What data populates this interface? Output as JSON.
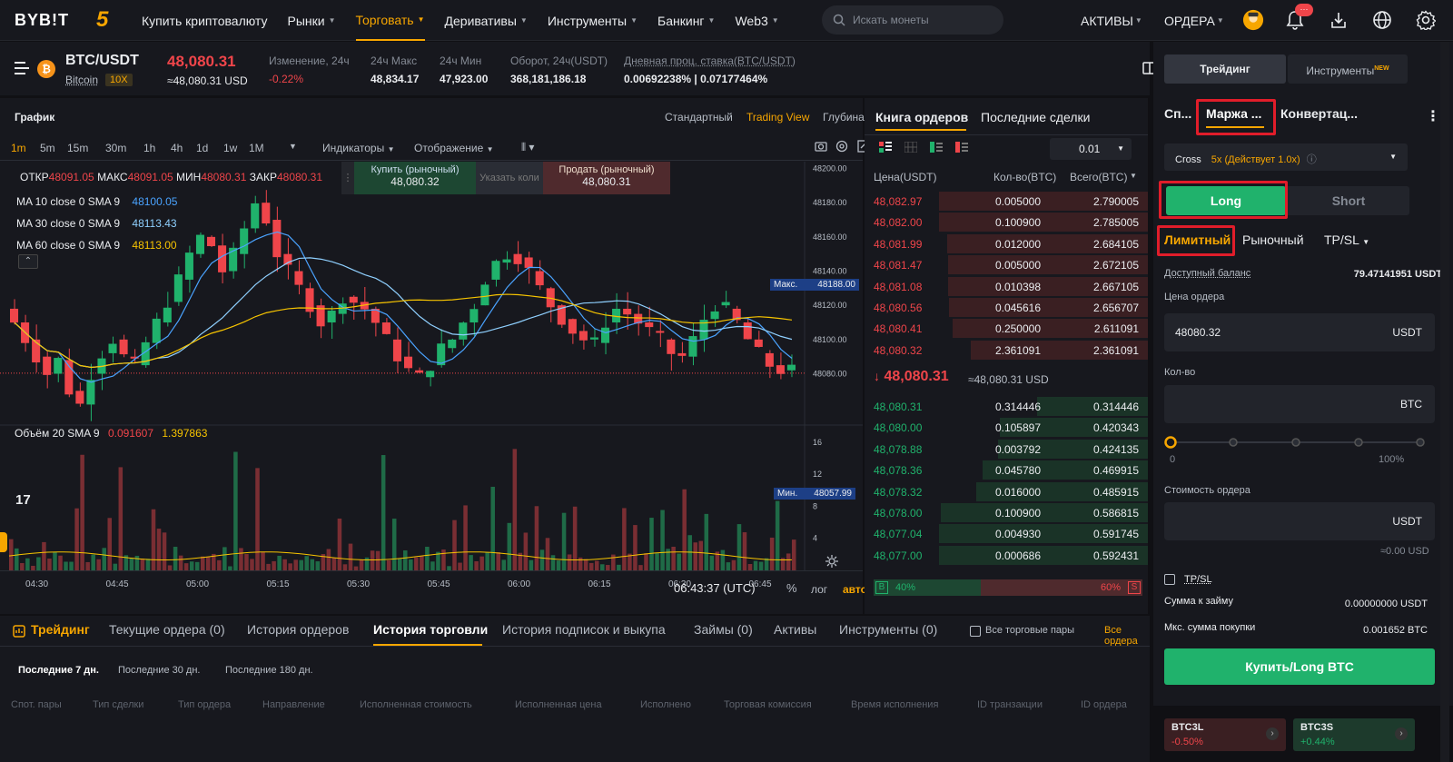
{
  "header": {
    "logo": "BYB!T",
    "five": "5",
    "nav": [
      "Купить криптовалюту",
      "Рынки",
      "Торговать",
      "Деривативы",
      "Инструменты",
      "Банкинг",
      "Web3"
    ],
    "search_placeholder": "Искать монеты",
    "assets": "АКТИВЫ",
    "orders": "ОРДЕРА",
    "notif_badge": "···"
  },
  "pair": {
    "symbol": "BTC/USDT",
    "name": "Bitcoin",
    "leverage": "10X",
    "price": "48,080.31",
    "price_usd": "≈48,080.31 USD",
    "change_label": "Изменение, 24ч",
    "change_value": "-0.22%",
    "high_label": "24ч Макс",
    "high_value": "48,834.17",
    "low_label": "24ч Мин",
    "low_value": "47,923.00",
    "turnover_label": "Оборот, 24ч(USDT)",
    "turnover_value": "368,181,186.18",
    "rate_label": "Дневная проц. ставка(BTC/USDT)",
    "rate_value": "0.00692238% | 0.07177464%"
  },
  "chart": {
    "title": "График",
    "views": [
      "Стандартный",
      "Trading View",
      "Глубина"
    ],
    "intervals": [
      "1m",
      "5m",
      "15m",
      "30m",
      "1h",
      "4h",
      "1d",
      "1w",
      "1M"
    ],
    "indicators_label": "Индикаторы",
    "display_label": "Отображение",
    "ohlc": {
      "o_label": "ОТКР",
      "o": "48091.05",
      "h_label": "МАКС",
      "h": "48091.05",
      "l_label": "МИН",
      "l": "48080.31",
      "c_label": "ЗАКР",
      "c": "48080.31"
    },
    "ma": [
      {
        "label": "MA 10 close 0 SMA 9",
        "value": "48100.05",
        "color": "#4aa3ff"
      },
      {
        "label": "MA 30 close 0 SMA 9",
        "value": "48113.43",
        "color": "#8fd0ff"
      },
      {
        "label": "MA 60 close 0 SMA 9",
        "value": "48113.00",
        "color": "#f7c400"
      }
    ],
    "quick": {
      "buy_label": "Купить (рыночный)",
      "buy_price": "48,080.32",
      "mid": "Указать коли",
      "sell_label": "Продать (рыночный)",
      "sell_price": "48,080.31"
    },
    "max_label": "Макс.",
    "max_value": "48188.00",
    "min_label": "Мин.",
    "min_value": "48057.99",
    "y_ticks": [
      "48200.00",
      "48180.00",
      "48160.00",
      "48140.00",
      "48120.00",
      "48100.00",
      "48080.00"
    ],
    "vol_label": "Объём 20 SMA 9",
    "vol_v1": "0.091607",
    "vol_v2": "1.397863",
    "vol_ticks": [
      "16",
      "12",
      "8",
      "4"
    ],
    "x_ticks": [
      "04:30",
      "04:45",
      "05:00",
      "05:15",
      "05:30",
      "05:45",
      "06:00",
      "06:15",
      "06:30",
      "06:45"
    ],
    "time": "06:43:37 (UTC)",
    "pct": "%",
    "log": "лог",
    "auto": "авто"
  },
  "chart_data": {
    "type": "candlestick",
    "price_range": [
      48057.99,
      48188.0
    ],
    "last_price": 48080.31
  },
  "orderbook": {
    "tabs": [
      "Книга ордеров",
      "Последние сделки"
    ],
    "step": "0.01",
    "headers": [
      "Цена(USDT)",
      "Кол-во(BTC)",
      "Всего(BTC)"
    ],
    "asks": [
      [
        "48,082.97",
        "0.005000",
        "2.790005"
      ],
      [
        "48,082.00",
        "0.100900",
        "2.785005"
      ],
      [
        "48,081.99",
        "0.012000",
        "2.684105"
      ],
      [
        "48,081.47",
        "0.005000",
        "2.672105"
      ],
      [
        "48,081.08",
        "0.010398",
        "2.667105"
      ],
      [
        "48,080.56",
        "0.045616",
        "2.656707"
      ],
      [
        "48,080.41",
        "0.250000",
        "2.611091"
      ],
      [
        "48,080.32",
        "2.361091",
        "2.361091"
      ]
    ],
    "mid_price": "48,080.31",
    "mid_usd": "≈48,080.31 USD",
    "bids": [
      [
        "48,080.31",
        "0.314446",
        "0.314446"
      ],
      [
        "48,080.00",
        "0.105897",
        "0.420343"
      ],
      [
        "48,078.88",
        "0.003792",
        "0.424135"
      ],
      [
        "48,078.36",
        "0.045780",
        "0.469915"
      ],
      [
        "48,078.32",
        "0.016000",
        "0.485915"
      ],
      [
        "48,078.00",
        "0.100900",
        "0.586815"
      ],
      [
        "48,077.04",
        "0.004930",
        "0.591745"
      ],
      [
        "48,077.00",
        "0.000686",
        "0.592431"
      ]
    ],
    "buy_pct": "40%",
    "sell_pct": "60%",
    "b": "B",
    "s": "S"
  },
  "panel": {
    "top_tabs": [
      "Трейдинг",
      "Инструменты"
    ],
    "new_badge": "NEW",
    "mode_tabs": [
      "Сп...",
      "Маржа ...",
      "Конвертац..."
    ],
    "cross": "Cross",
    "leverage": "5x (Действует 1.0x)",
    "long": "Long",
    "short": "Short",
    "order_types": [
      "Лимитный",
      "Рыночный",
      "TP/SL"
    ],
    "available_label": "Доступный баланс",
    "available_value": "79.47141951 USDT",
    "order_price_label": "Цена ордера",
    "order_price_value": "48080.32",
    "usdt": "USDT",
    "qty_label": "Кол-во",
    "btc": "BTC",
    "slider_min": "0",
    "slider_max": "100%",
    "cost_label": "Стоимость ордера",
    "cost_usd": "≈0.00 USD",
    "tpsl": "TP/SL",
    "loan_label": "Сумма к займу",
    "loan_value": "0.00000000 USDT",
    "maxbuy_label": "Мкс. сумма покупки",
    "maxbuy_value": "0.001652 BTC",
    "submit": "Купить/Long BTC",
    "lev_tokens": [
      {
        "name": "BTC3L",
        "change": "-0.50%"
      },
      {
        "name": "BTC3S",
        "change": "+0.44%"
      }
    ]
  },
  "bottom": {
    "tabs": [
      "Трейдинг",
      "Текущие ордера (0)",
      "История ордеров",
      "История торговли",
      "История подписок и выкупа",
      "Займы (0)",
      "Активы",
      "Инструменты (0)"
    ],
    "all_pairs": "Все торговые пары",
    "all_orders": "Все ордера",
    "periods": [
      "Последние 7 дн.",
      "Последние 30 дн.",
      "Последние 180 дн."
    ],
    "columns": [
      "Спот. пары",
      "Тип сделки",
      "Тип ордера",
      "Направление",
      "Исполненная стоимость",
      "Исполненная цена",
      "Исполнено",
      "Торговая комиссия",
      "Время исполнения",
      "ID транзакции",
      "ID ордера"
    ]
  }
}
